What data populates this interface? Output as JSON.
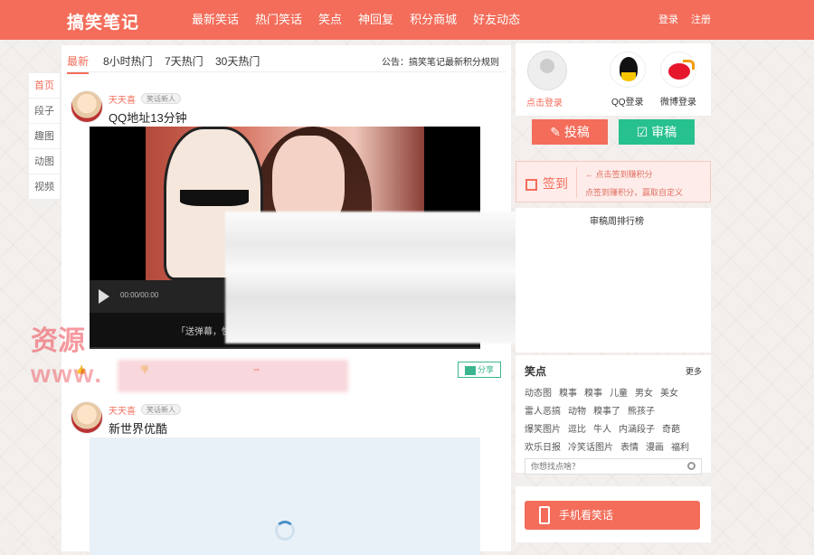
{
  "header": {
    "logo": "搞笑笔记",
    "nav": [
      "最新笑话",
      "热门笑话",
      "笑点",
      "神回复",
      "积分商城",
      "好友动态"
    ],
    "login": "登录",
    "register": "注册"
  },
  "sidenav": [
    "首页",
    "段子",
    "趣图",
    "动图",
    "视频"
  ],
  "tabs": [
    "最新",
    "8小时热门",
    "7天热门",
    "30天热门"
  ],
  "notice": "公告：搞笑笔记最新积分规则",
  "posts": [
    {
      "user": "天天喜",
      "badge": "笑话新人",
      "title": "QQ地址13分钟",
      "timecode": "00:00/00:00",
      "danmu": "「送弹幕，快来…",
      "share": "分享"
    },
    {
      "user": "天天喜",
      "badge": "笑话新人",
      "title": "新世界优酷"
    }
  ],
  "side": {
    "login_link": "点击登录",
    "qq_label": "QQ登录",
    "weibo_label": "微博登录",
    "submit": "投稿",
    "review": "审稿",
    "checkin": "签到",
    "checkin_tip1": "← 点击签到赚积分",
    "checkin_tip2": "点签到赚积分，赢取自定义",
    "rank_title": "审稿周排行榜",
    "tags_title": "笑点",
    "tags_more": "更多",
    "tags": [
      [
        "动态图",
        "糗事",
        "糗事",
        "儿童",
        "男女",
        "美女"
      ],
      [
        "雷人恶搞",
        "动物",
        "糗事了",
        "熊孩子"
      ],
      [
        "爆笑图片",
        "逗比",
        "牛人",
        "内涵段子",
        "奇葩"
      ],
      [
        "欢乐日报",
        "冷笑话图片",
        "表情",
        "漫画",
        "福利"
      ]
    ],
    "search_placeholder": "你想找点啥？",
    "mobile": "手机看笑话"
  },
  "watermark": {
    "line1": "资源",
    "line2": "www."
  },
  "colors": {
    "brand": "#f36d5a",
    "green": "#27c08f"
  }
}
